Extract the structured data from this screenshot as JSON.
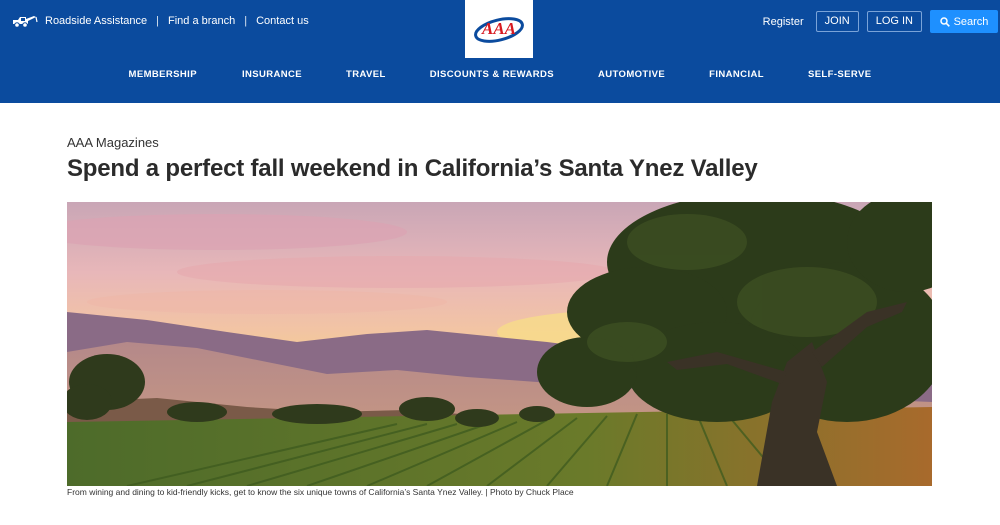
{
  "utility_nav": {
    "roadside": "Roadside Assistance",
    "separator": "|",
    "find_branch": "Find a branch",
    "contact": "Contact us"
  },
  "logo": {
    "text": "AAA"
  },
  "account": {
    "register": "Register",
    "join": "JOIN",
    "login": "LOG IN",
    "search": "Search"
  },
  "main_nav": [
    "MEMBERSHIP",
    "INSURANCE",
    "TRAVEL",
    "DISCOUNTS & REWARDS",
    "AUTOMOTIVE",
    "FINANCIAL",
    "SELF-SERVE"
  ],
  "article": {
    "section": "AAA Magazines",
    "title": "Spend a perfect fall weekend in California’s Santa Ynez Valley",
    "caption": "From wining and dining to kid-friendly kicks, get to know the six unique towns of California’s Santa Ynez Valley. | Photo by Chuck Place"
  },
  "colors": {
    "header_bg": "#0b4b9e",
    "search_button": "#1e90ff",
    "logo_red": "#d71920",
    "logo_blue": "#0b4b9e"
  }
}
